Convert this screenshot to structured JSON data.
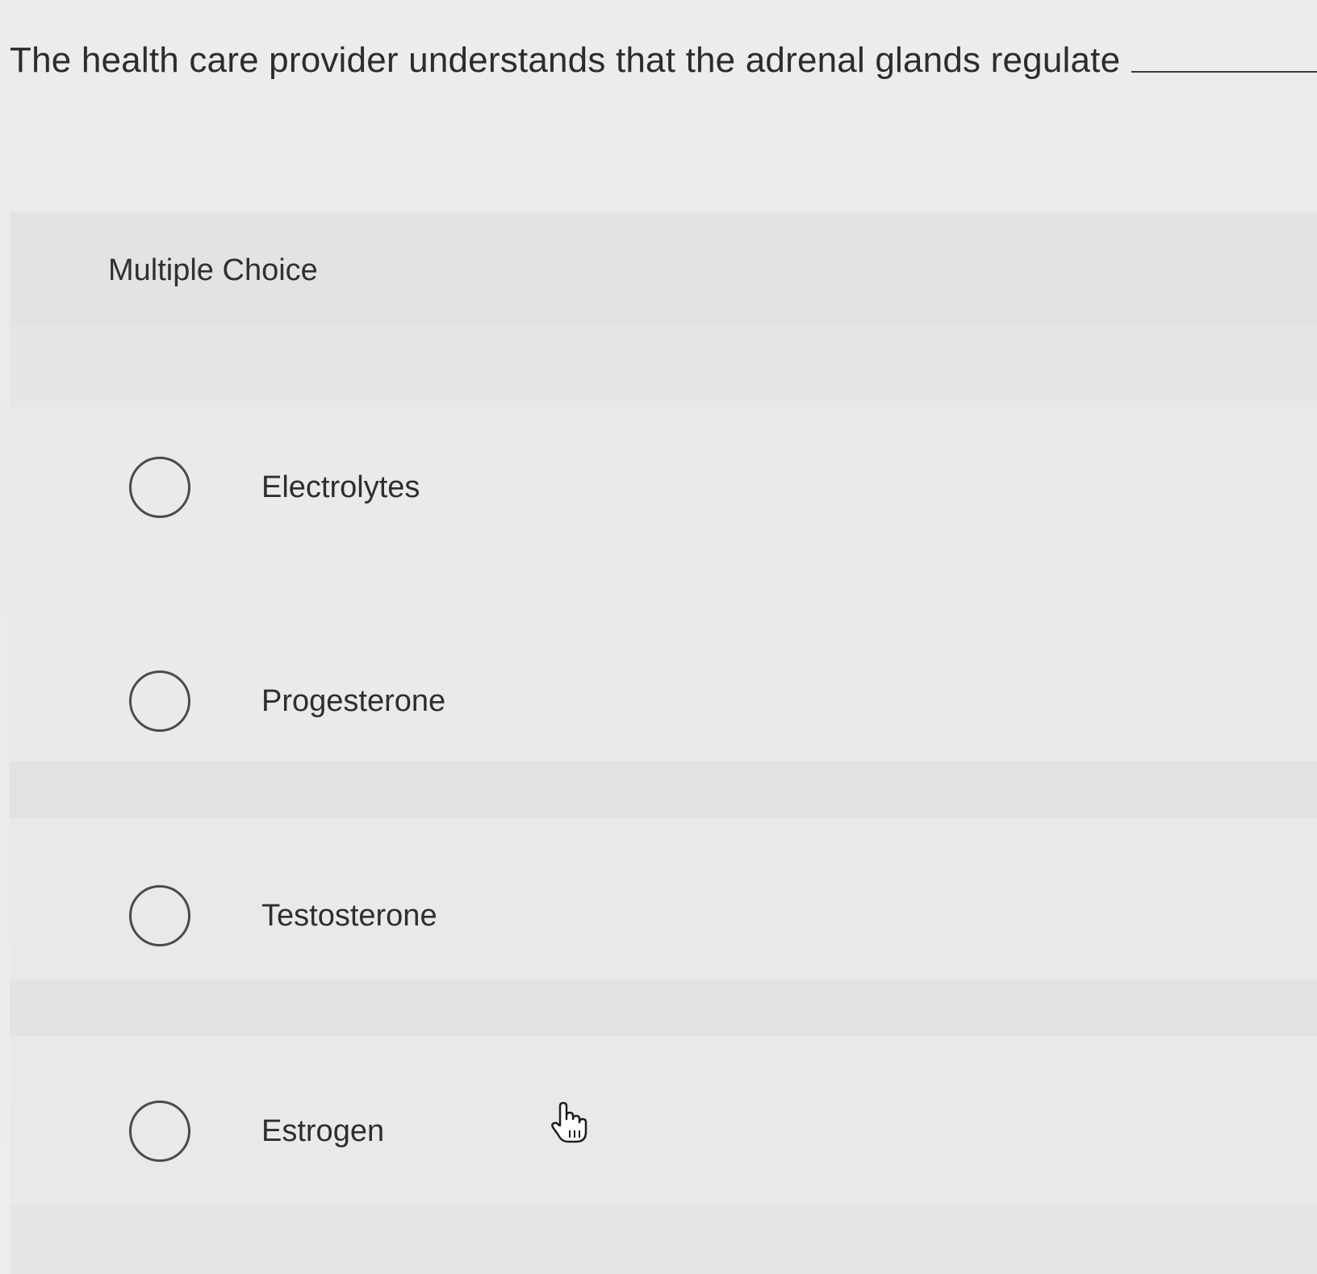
{
  "question": {
    "text": "The health care provider understands that the adrenal glands regulate"
  },
  "panel": {
    "type_label": "Multiple Choice"
  },
  "options": [
    {
      "label": "Electrolytes",
      "selected": false
    },
    {
      "label": "Progesterone",
      "selected": false
    },
    {
      "label": "Testosterone",
      "selected": false
    },
    {
      "label": "Estrogen",
      "selected": false
    }
  ],
  "cursor": {
    "icon": "hand-pointer-icon"
  }
}
